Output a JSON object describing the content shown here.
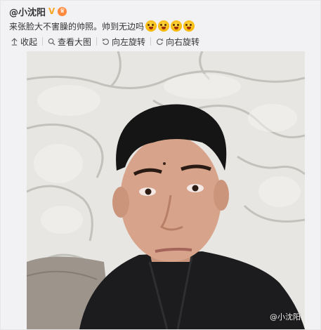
{
  "post": {
    "username": "@小沈阳",
    "verified_badge": "V",
    "text": "来张脸大不害臊的帅照。帅到无边吗",
    "emoji_count": 4
  },
  "toolbar": {
    "collapse_label": "收起",
    "view_large_label": "查看大图",
    "rotate_left_label": "向左旋转",
    "rotate_right_label": "向右旋转"
  },
  "photo": {
    "watermark": "@小沈阳"
  },
  "colors": {
    "text": "#333333",
    "badge": "#f5a623",
    "background": "#f2f2f5"
  }
}
